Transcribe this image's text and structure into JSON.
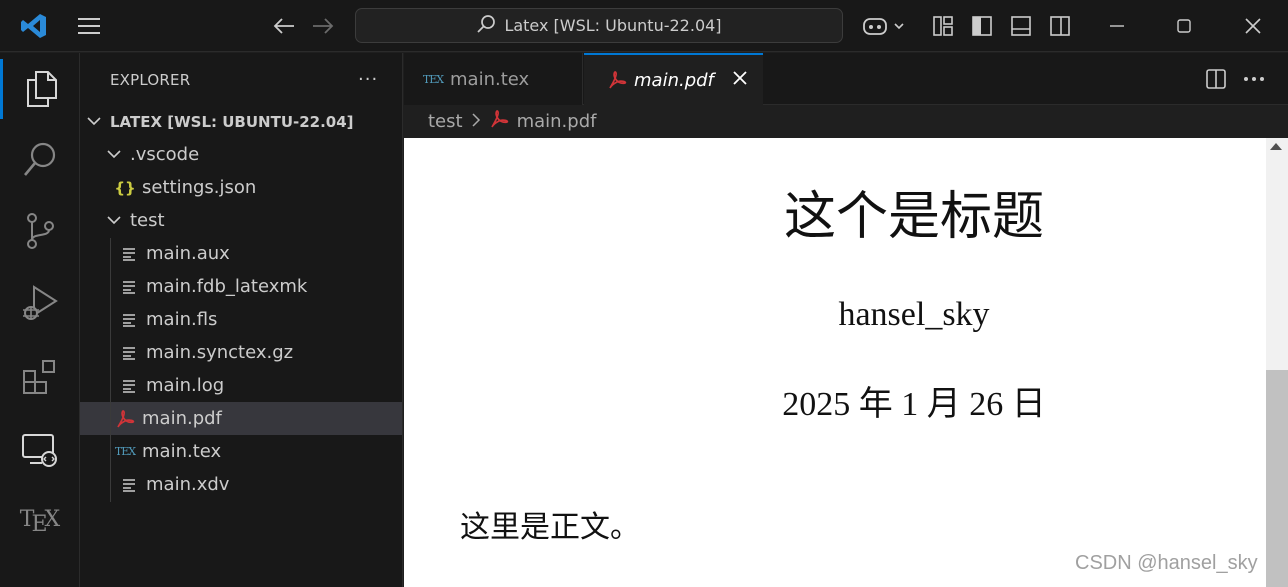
{
  "titlebar": {
    "search_text": "Latex [WSL: Ubuntu-22.04]"
  },
  "activitybar": {
    "items": [
      "explorer",
      "search",
      "source-control",
      "run-and-debug",
      "extensions",
      "remote-explorer",
      "tex"
    ],
    "tex_label_t": "T",
    "tex_label_e": "E",
    "tex_label_x": "X"
  },
  "sidebar": {
    "header": "EXPLORER",
    "more": "···",
    "root": "LATEX [WSL: UBUNTU-22.04]",
    "tree": [
      {
        "label": ".vscode",
        "type": "folder",
        "level": 1
      },
      {
        "label": "settings.json",
        "type": "json",
        "level": 2
      },
      {
        "label": "test",
        "type": "folder",
        "level": 1
      },
      {
        "label": "main.aux",
        "type": "file",
        "level": 2
      },
      {
        "label": "main.fdb_latexmk",
        "type": "file",
        "level": 2
      },
      {
        "label": "main.fls",
        "type": "file",
        "level": 2
      },
      {
        "label": "main.synctex.gz",
        "type": "file",
        "level": 2
      },
      {
        "label": "main.log",
        "type": "file",
        "level": 2
      },
      {
        "label": "main.pdf",
        "type": "pdf",
        "level": 2,
        "selected": true
      },
      {
        "label": "main.tex",
        "type": "tex",
        "level": 2
      },
      {
        "label": "main.xdv",
        "type": "file",
        "level": 2
      }
    ],
    "json_glyph": "{}",
    "tex_glyph": "TEX"
  },
  "tabs": [
    {
      "label": "main.tex",
      "active": false
    },
    {
      "label": "main.pdf",
      "active": true
    }
  ],
  "breadcrumb": {
    "folder": "test",
    "file": "main.pdf"
  },
  "pdf": {
    "title": "这个是标题",
    "author": "hansel_sky",
    "date": "2025 年 1 月 26 日",
    "body": "这里是正文。"
  },
  "watermark": "CSDN @hansel_sky",
  "colors": {
    "accent": "#0078d4",
    "pdf_icon": "#d13438",
    "json_icon": "#cbcb41",
    "tex_icon": "#519aba"
  }
}
